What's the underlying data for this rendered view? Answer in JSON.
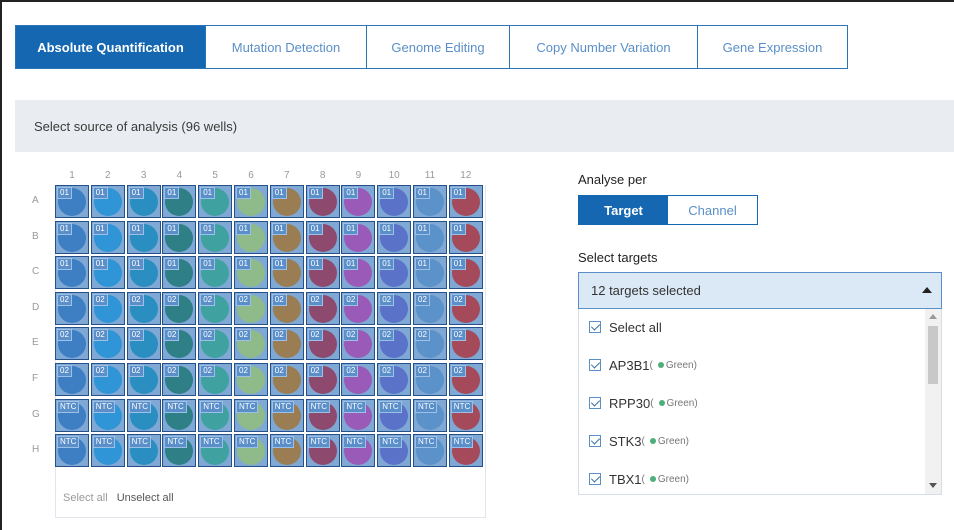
{
  "tabs": [
    {
      "label": "Absolute Quantification",
      "active": true
    },
    {
      "label": "Mutation Detection",
      "active": false
    },
    {
      "label": "Genome Editing",
      "active": false
    },
    {
      "label": "Copy Number Variation",
      "active": false
    },
    {
      "label": "Gene Expression",
      "active": false
    }
  ],
  "section_title": "Select source of analysis (96 wells)",
  "plate": {
    "columns": [
      "1",
      "2",
      "3",
      "4",
      "5",
      "6",
      "7",
      "8",
      "9",
      "10",
      "11",
      "12"
    ],
    "rows": [
      "A",
      "B",
      "C",
      "D",
      "E",
      "F",
      "G",
      "H"
    ],
    "row_well_labels": [
      "01",
      "01",
      "01",
      "02",
      "02",
      "02",
      "NTC",
      "NTC"
    ],
    "column_colors": [
      "#3e7fc4",
      "#2f95d6",
      "#2a8fc0",
      "#2f7f86",
      "#3fa1a0",
      "#8fbb8a",
      "#9a7d52",
      "#8e4a6e",
      "#9a5ab8",
      "#5b72c9",
      "#5b92c9",
      "#a44a5a"
    ],
    "select_all": "Select all",
    "unselect_all": "Unselect all"
  },
  "analyse": {
    "label": "Analyse per",
    "options": [
      "Target",
      "Channel"
    ],
    "selected": "Target"
  },
  "targets": {
    "label": "Select targets",
    "summary": "12 targets selected",
    "items": [
      {
        "name": "Select all",
        "channel": ""
      },
      {
        "name": "AP3B1",
        "channel": "Green"
      },
      {
        "name": "RPP30",
        "channel": "Green"
      },
      {
        "name": "STK3",
        "channel": "Green"
      },
      {
        "name": "TBX1",
        "channel": "Green"
      }
    ]
  }
}
